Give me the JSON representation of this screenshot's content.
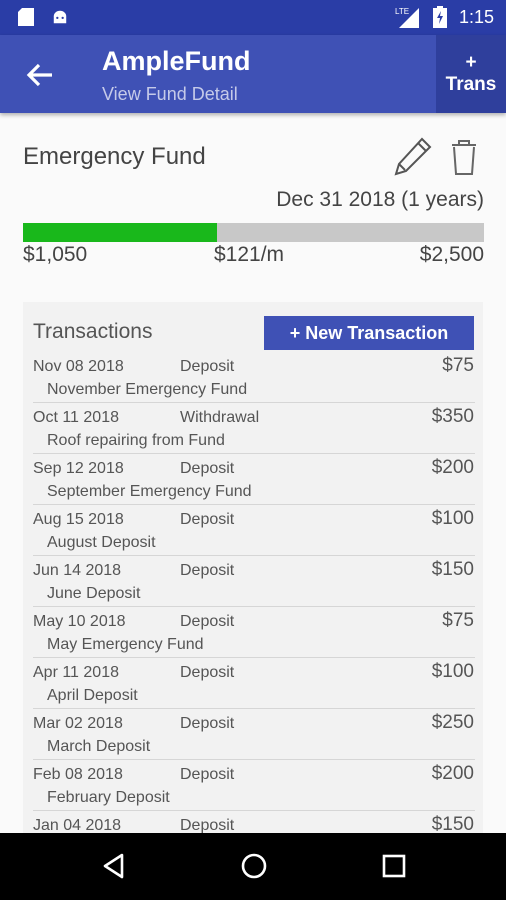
{
  "status": {
    "time": "1:15",
    "network": "LTE"
  },
  "appbar": {
    "title": "AmpleFund",
    "subtitle": "View Fund Detail",
    "trans_plus": "+",
    "trans_label": "Trans"
  },
  "fund": {
    "name": "Emergency Fund",
    "due": "Dec 31 2018 (1 years)",
    "saved": "$1,050",
    "monthly": "$121/m",
    "goal": "$2,500",
    "progress": 0.42
  },
  "transactions": {
    "title": "Transactions",
    "new_button": "+ New Transaction",
    "rows": [
      {
        "date": "Nov 08 2018",
        "type": "Deposit",
        "amount": "$75",
        "desc": "November Emergency Fund"
      },
      {
        "date": "Oct 11 2018",
        "type": "Withdrawal",
        "amount": "$350",
        "desc": "Roof repairing from Fund"
      },
      {
        "date": "Sep 12 2018",
        "type": "Deposit",
        "amount": "$200",
        "desc": "September Emergency Fund"
      },
      {
        "date": "Aug 15 2018",
        "type": "Deposit",
        "amount": "$100",
        "desc": "August Deposit"
      },
      {
        "date": "Jun 14 2018",
        "type": "Deposit",
        "amount": "$150",
        "desc": "June Deposit"
      },
      {
        "date": "May 10 2018",
        "type": "Deposit",
        "amount": "$75",
        "desc": "May Emergency Fund"
      },
      {
        "date": "Apr 11 2018",
        "type": "Deposit",
        "amount": "$100",
        "desc": "April Deposit"
      },
      {
        "date": "Mar 02 2018",
        "type": "Deposit",
        "amount": "$250",
        "desc": "March Deposit"
      },
      {
        "date": "Feb 08 2018",
        "type": "Deposit",
        "amount": "$200",
        "desc": "February Deposit"
      },
      {
        "date": "Jan 04 2018",
        "type": "Deposit",
        "amount": "$150",
        "desc": ""
      }
    ]
  },
  "colors": {
    "primary": "#3f51b5",
    "primary_dark": "#2a3da6",
    "progress": "#19b81b"
  }
}
